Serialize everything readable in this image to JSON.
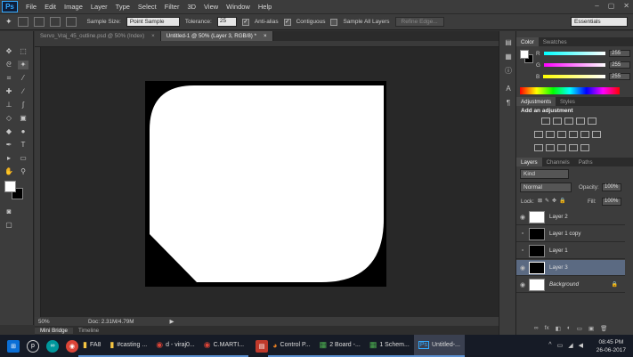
{
  "app": {
    "logo": "Ps"
  },
  "menu": [
    "File",
    "Edit",
    "Image",
    "Layer",
    "Type",
    "Select",
    "Filter",
    "3D",
    "View",
    "Window",
    "Help"
  ],
  "window_controls": [
    "–",
    "▢",
    "✕"
  ],
  "options": {
    "sample_size_label": "Sample Size:",
    "sample_size_value": "Point Sample",
    "tolerance_label": "Tolerance:",
    "tolerance_value": "25",
    "anti_alias": "Anti-alias",
    "contiguous": "Contiguous",
    "sample_all_layers": "Sample All Layers",
    "refine_edge": "Refine Edge...",
    "workspace": "Essentials"
  },
  "tabs": [
    {
      "label": "Servo_Vraj_45_outline.psd @ 50% (Index)",
      "close": "×"
    },
    {
      "label": "Untitled-1 @ 50% (Layer 3, RGB/8) *",
      "close": "×"
    }
  ],
  "status": {
    "zoom": "50%",
    "doc_info": "Doc: 2.31M/4.79M",
    "arrow": "▶"
  },
  "bottom_tabs": [
    "Mini Bridge",
    "Timeline"
  ],
  "color_panel": {
    "tabs": [
      "Color",
      "Swatches"
    ],
    "r_label": "R",
    "r_value": "255",
    "g_label": "G",
    "g_value": "255",
    "b_label": "B",
    "b_value": "255"
  },
  "adjustments_panel": {
    "tabs": [
      "Adjustments",
      "Styles"
    ],
    "heading": "Add an adjustment"
  },
  "layers_panel": {
    "tabs": [
      "Layers",
      "Channels",
      "Paths"
    ],
    "kind": "Kind",
    "blend_mode": "Normal",
    "opacity_label": "Opacity:",
    "opacity_value": "100%",
    "lock_label": "Lock:",
    "fill_label": "Fill:",
    "fill_value": "100%",
    "layers": [
      {
        "name": "Layer 2",
        "visible": true,
        "thumb": "white"
      },
      {
        "name": "Layer 1 copy",
        "visible": false,
        "thumb": "black"
      },
      {
        "name": "Layer 1",
        "visible": false,
        "thumb": "black"
      },
      {
        "name": "Layer 3",
        "visible": true,
        "thumb": "black",
        "selected": true
      },
      {
        "name": "Background",
        "visible": true,
        "thumb": "white"
      }
    ],
    "footer_icons": [
      "∞",
      "fx",
      "◧",
      "◐",
      "▭",
      "▣",
      "🗑"
    ]
  },
  "taskbar": {
    "items": [
      {
        "label": "FA8",
        "icon": "folder"
      },
      {
        "label": "#casting ...",
        "icon": "folder"
      },
      {
        "label": "d - viraj0...",
        "icon": "chrome"
      },
      {
        "label": "C.MARTI...",
        "icon": "chrome"
      },
      {
        "label": "Control P...",
        "icon": "control-panel"
      },
      {
        "label": "2 Board -...",
        "icon": "board"
      },
      {
        "label": "1 Schem...",
        "icon": "board"
      },
      {
        "label": "Untitled-...",
        "icon": "photoshop"
      }
    ],
    "time": "08:45 PM",
    "date": "26-06-2017"
  },
  "colors": {
    "accent": "#3399ff",
    "selected_layer": "#5b6a82",
    "panel_bg": "#3c3c3c",
    "canvas_bg": "#282828"
  }
}
